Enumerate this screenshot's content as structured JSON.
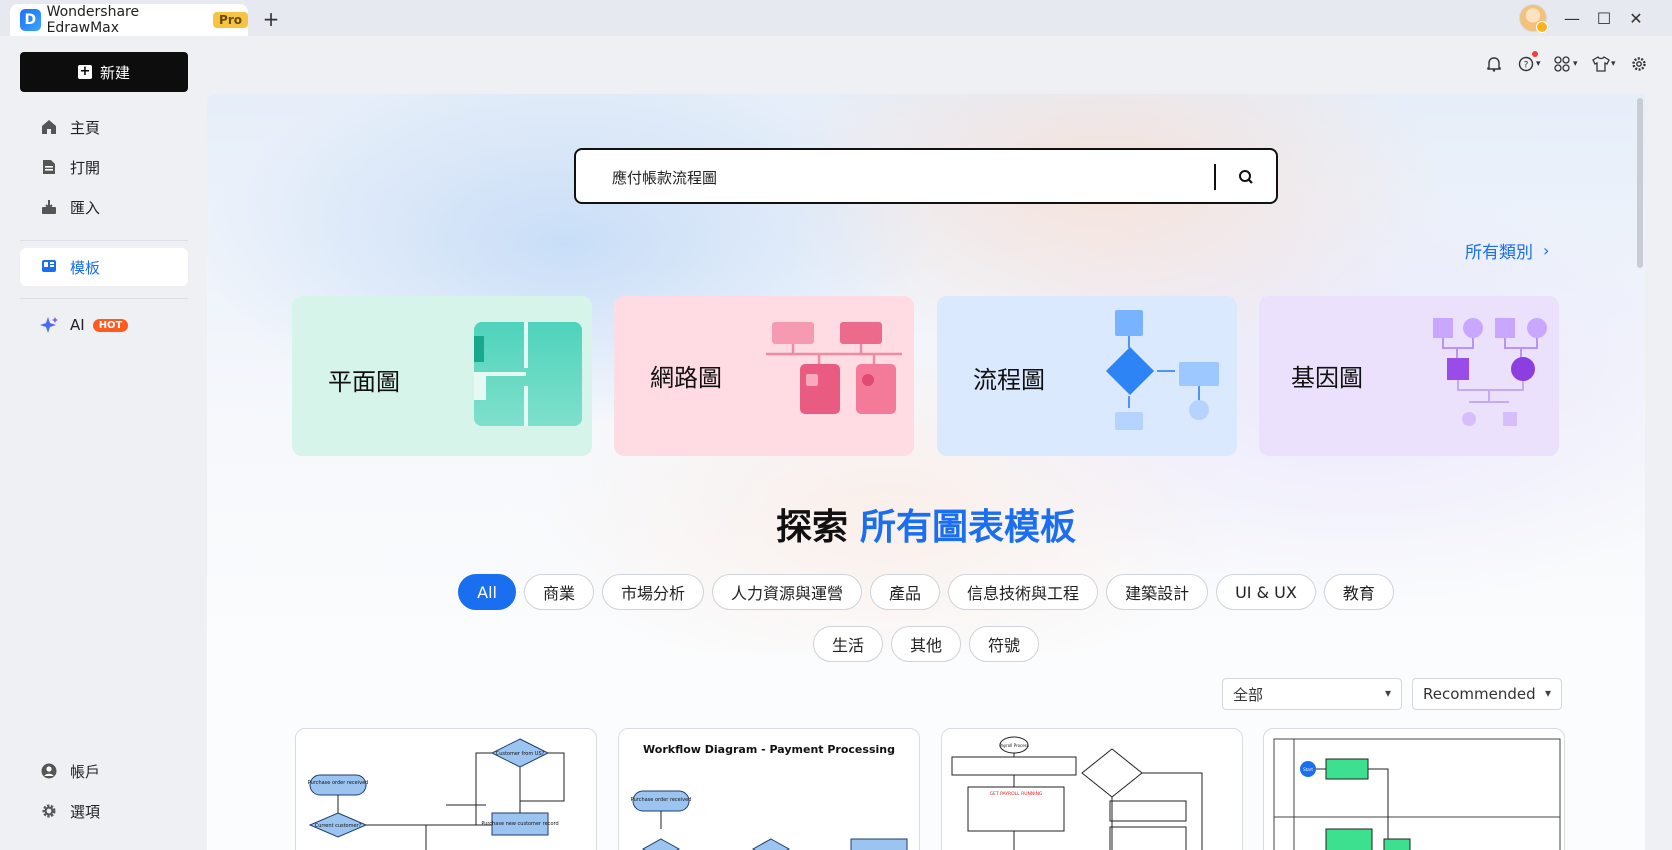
{
  "window": {
    "app_name": "Wondershare EdrawMax",
    "pro_label": "Pro",
    "new_tab": "+",
    "minimize": "—",
    "maximize": "☐",
    "close": "✕"
  },
  "sidebar": {
    "new_label": "新建",
    "items": [
      {
        "label": "主頁",
        "icon": "home-icon"
      },
      {
        "label": "打開",
        "icon": "file-icon"
      },
      {
        "label": "匯入",
        "icon": "import-icon"
      },
      {
        "label": "模板",
        "icon": "template-icon",
        "active": true
      },
      {
        "label": "AI",
        "icon": "ai-sparkle-icon",
        "badge": "HOT"
      }
    ],
    "bottom_items": [
      {
        "label": "帳戶",
        "icon": "account-icon"
      },
      {
        "label": "選項",
        "icon": "gear-icon"
      }
    ]
  },
  "toolbar": {
    "icons": [
      "bell-icon",
      "help-icon",
      "apps-icon",
      "shirt-icon",
      "settings-icon"
    ]
  },
  "search": {
    "value": "應付帳款流程圖",
    "icon": "search-icon"
  },
  "all_categories": {
    "label": "所有類別",
    "chevron": "›"
  },
  "category_cards": [
    {
      "label": "平面圖",
      "bg": "#d8f5ec"
    },
    {
      "label": "網路圖",
      "bg": "#ffdde5"
    },
    {
      "label": "流程圖",
      "bg": "#dceaff"
    },
    {
      "label": "基因圖",
      "bg": "#ece2fd"
    }
  ],
  "explore": {
    "prefix": "探索",
    "highlight": "所有圖表模板"
  },
  "filter_chips_row1": [
    "All",
    "商業",
    "市場分析",
    "人力資源與運營",
    "產品",
    "信息技術與工程",
    "建築設計",
    "UI & UX",
    "教育"
  ],
  "filter_chips_row2": [
    "生活",
    "其他",
    "符號"
  ],
  "dropdowns": {
    "scope": "全部",
    "sort": "Recommended"
  },
  "templates": [
    {
      "title": "",
      "labels": [
        "Purchase order received",
        "Customer from US?",
        "Current customer?",
        "Purchase new customer record"
      ]
    },
    {
      "title": "Workflow Diagram - Payment Processing",
      "labels": [
        "Purchase order received"
      ]
    },
    {
      "title": "",
      "labels": [
        "Payroll Process",
        "GET PAYROLL RUNNING"
      ]
    },
    {
      "title": "",
      "labels": [
        "Start"
      ]
    }
  ],
  "colors": {
    "accent": "#1a6ff0",
    "hot": "#ff5a1f",
    "pro": "#f6c343"
  }
}
